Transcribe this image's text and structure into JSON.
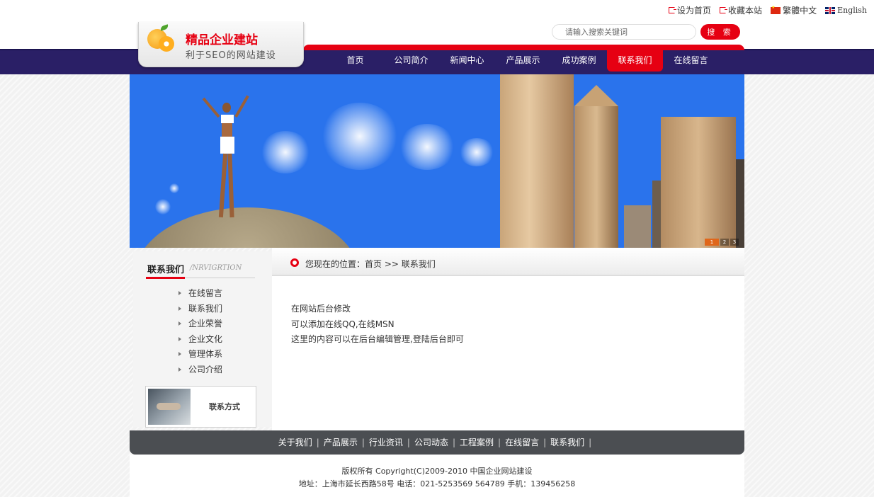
{
  "top_links": {
    "set_home": "设为首页",
    "bookmark": "收藏本站",
    "traditional": "繁體中文",
    "english": "English"
  },
  "search": {
    "placeholder": "请输入搜索关键词",
    "button": "搜 索"
  },
  "logo": {
    "title": "精品企业建站",
    "subtitle": "利于SEO的网站建设"
  },
  "nav": {
    "items": [
      "首页",
      "公司简介",
      "新闻中心",
      "产品展示",
      "成功案例",
      "联系我们",
      "在线留言"
    ],
    "active": "联系我们"
  },
  "banner": {
    "pager": [
      "1",
      "2",
      "3"
    ],
    "current": "1"
  },
  "sidebar": {
    "title": "联系我们",
    "title_en": "/NRVIGRTION",
    "items": [
      "在线留言",
      "联系我们",
      "企业荣誉",
      "企业文化",
      "管理体系",
      "公司介绍"
    ],
    "contact_label": "联系方式"
  },
  "breadcrumb": {
    "prefix": "您现在的位置：",
    "home": "首页",
    "separator": ">>",
    "current": "联系我们"
  },
  "content": {
    "lines": [
      "在网站后台修改",
      "可以添加在线QQ,在线MSN",
      "这里的内容可以在后台编辑管理,登陆后台即可"
    ]
  },
  "footer": {
    "links": [
      "关于我们",
      "产品展示",
      "行业资讯",
      "公司动态",
      "工程案例",
      "在线留言",
      "联系我们"
    ],
    "separator": "|",
    "copyright": "版权所有 Copyright(C)2009-2010 中国企业网站建设",
    "address": "地址：上海市延长西路58号 电话：021-5253569 564789 手机：139456258"
  },
  "colors": {
    "accent": "#e60012",
    "nav_bg": "#2a1f66",
    "footer_bg": "#4b4e52",
    "banner_sky": "#2a73ec"
  }
}
